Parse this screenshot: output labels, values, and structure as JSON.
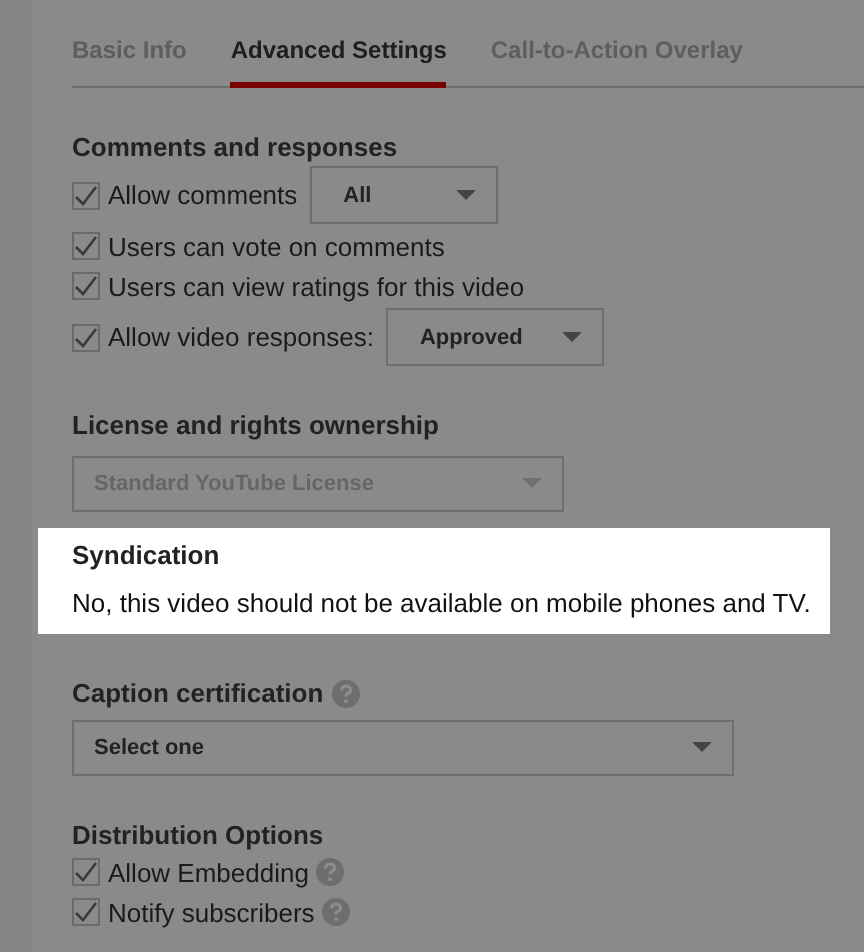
{
  "tabs": [
    {
      "label": "Basic Info",
      "selected": false
    },
    {
      "label": "Advanced Settings",
      "selected": true
    },
    {
      "label": "Call-to-Action Overlay",
      "selected": false
    }
  ],
  "comments": {
    "heading": "Comments and responses",
    "options": [
      {
        "label": "Allow comments",
        "checked": true,
        "dropdown": "All"
      },
      {
        "label": "Users can vote on comments",
        "checked": true
      },
      {
        "label": "Users can view ratings for this video",
        "checked": true
      },
      {
        "label": "Allow video responses:",
        "checked": true,
        "dropdown": "Approved"
      }
    ]
  },
  "license": {
    "heading": "License and rights ownership",
    "select": {
      "value": "Standard YouTube License",
      "disabled": true
    }
  },
  "syndication": {
    "heading": "Syndication",
    "text": "No, this video should not be available on mobile phones and TV.",
    "highlighted": true
  },
  "caption": {
    "heading": "Caption certification",
    "help": true,
    "select": {
      "value": "Select one",
      "disabled": false
    }
  },
  "distribution": {
    "heading": "Distribution Options",
    "options": [
      {
        "label": "Allow Embedding",
        "checked": true,
        "help": true
      },
      {
        "label": "Notify subscribers",
        "checked": true,
        "help": true
      }
    ]
  }
}
